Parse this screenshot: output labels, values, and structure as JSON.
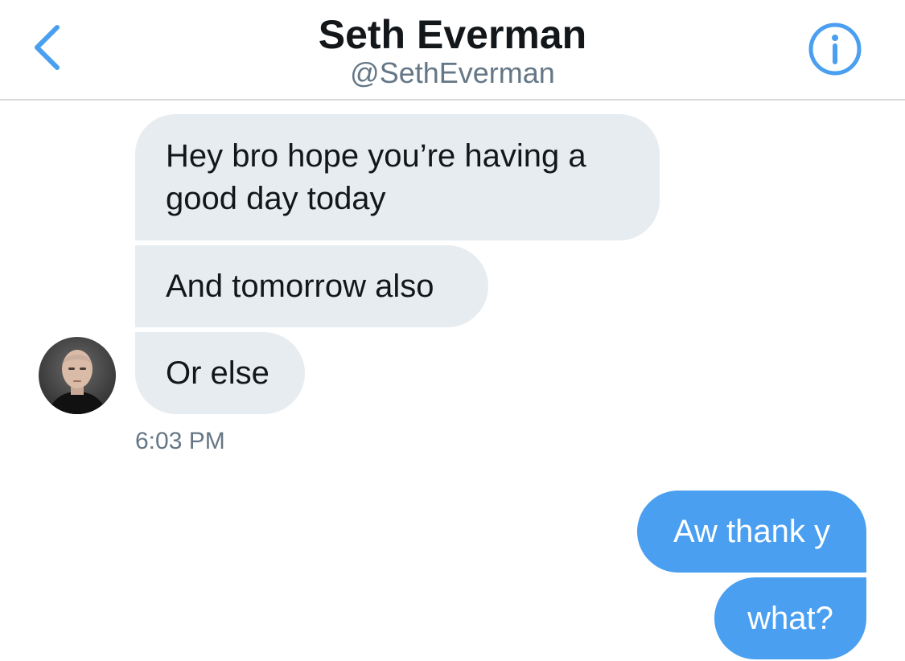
{
  "header": {
    "title": "Seth Everman",
    "handle": "@SethEverman",
    "back_icon": "chevron-left-icon",
    "info_icon": "info-circle-icon"
  },
  "conversation": {
    "incoming": [
      {
        "text": "Hey bro hope you’re having a good day today"
      },
      {
        "text": "And tomorrow also"
      },
      {
        "text": "Or else"
      }
    ],
    "incoming_timestamp": "6:03 PM",
    "outgoing": [
      {
        "text": "Aw thank y"
      },
      {
        "text": "what?"
      }
    ]
  },
  "colors": {
    "accent": "#4a9ff0",
    "incoming_bubble": "#e6ecf0",
    "text_primary": "#14171a",
    "text_secondary": "#657786",
    "divider": "#d6d9dc"
  }
}
